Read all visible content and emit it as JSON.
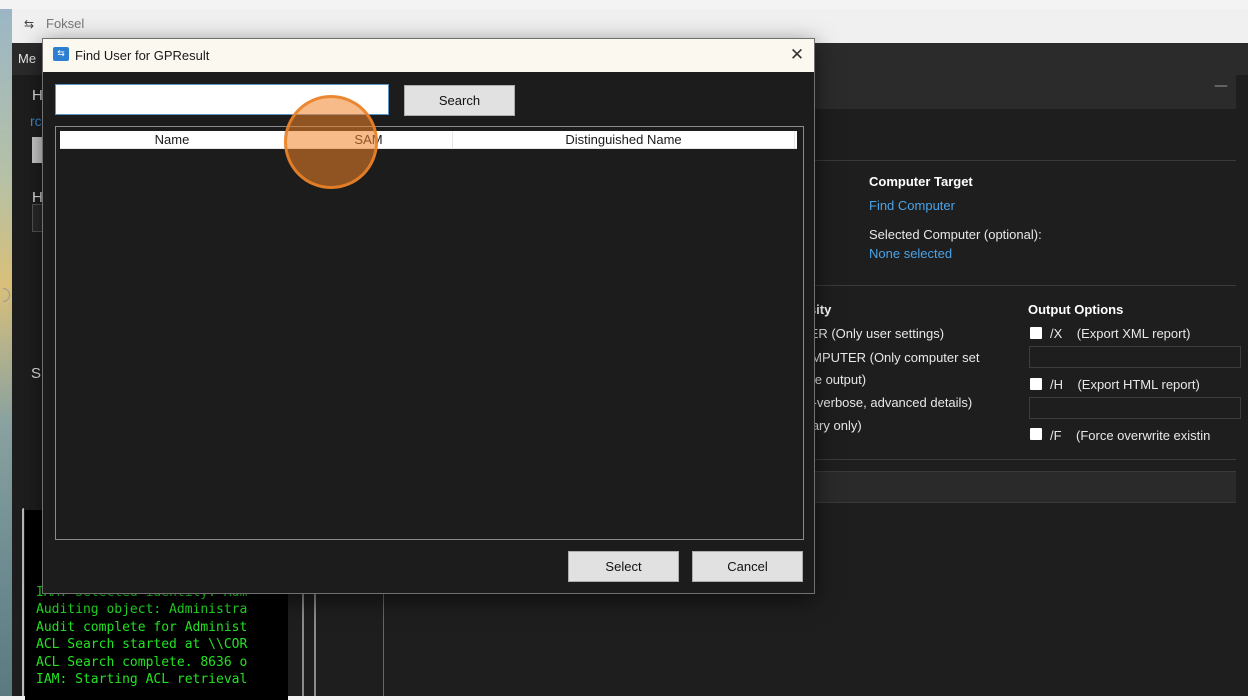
{
  "main_window": {
    "title": "Foksel",
    "menu_text": "Me",
    "left_heading_1": "H",
    "left_link": "rc",
    "left_heading_2": "H",
    "left_label_sh": "Sl"
  },
  "computer_target": {
    "heading": "Computer Target",
    "find_link": "Find Computer",
    "selected_label": "Selected Computer (optional):",
    "selected_value": "None selected"
  },
  "verbosity": {
    "heading": "osity",
    "options": [
      "SER    (Only user settings)",
      "OMPUTER    (Only computer set",
      "ose output)",
      "er-verbose, advanced details)",
      "mary only)"
    ]
  },
  "output_options": {
    "heading": "Output Options",
    "xml": {
      "flag": "/X",
      "label": "(Export XML report)"
    },
    "html": {
      "flag": "/H",
      "label": "(Export HTML report)"
    },
    "force": {
      "flag": "/F",
      "label": "(Force overwrite existin"
    }
  },
  "console": {
    "lines": [
      "IAM: Selected identity: Adm",
      "Auditing object: Administra",
      "Audit complete for Administ",
      "ACL Search started at \\\\COR",
      "ACL Search complete. 8636 o",
      "IAM: Starting ACL retrieval"
    ]
  },
  "dialog": {
    "title": "Find User for GPResult",
    "close_glyph": "✕",
    "search_input": {
      "value": "",
      "placeholder": ""
    },
    "search_button": "Search",
    "columns": [
      "Name",
      "SAM",
      "Distinguished Name"
    ],
    "rows": [],
    "select_button": "Select",
    "cancel_button": "Cancel"
  },
  "icons": {
    "app_icon": "app-icon",
    "dialog_icon": "dialog-app-icon",
    "close": "close-icon",
    "checkbox": "checkbox"
  },
  "colors": {
    "link": "#4aa3e6",
    "console_text": "#22e222",
    "click_marker": "#f08228"
  }
}
